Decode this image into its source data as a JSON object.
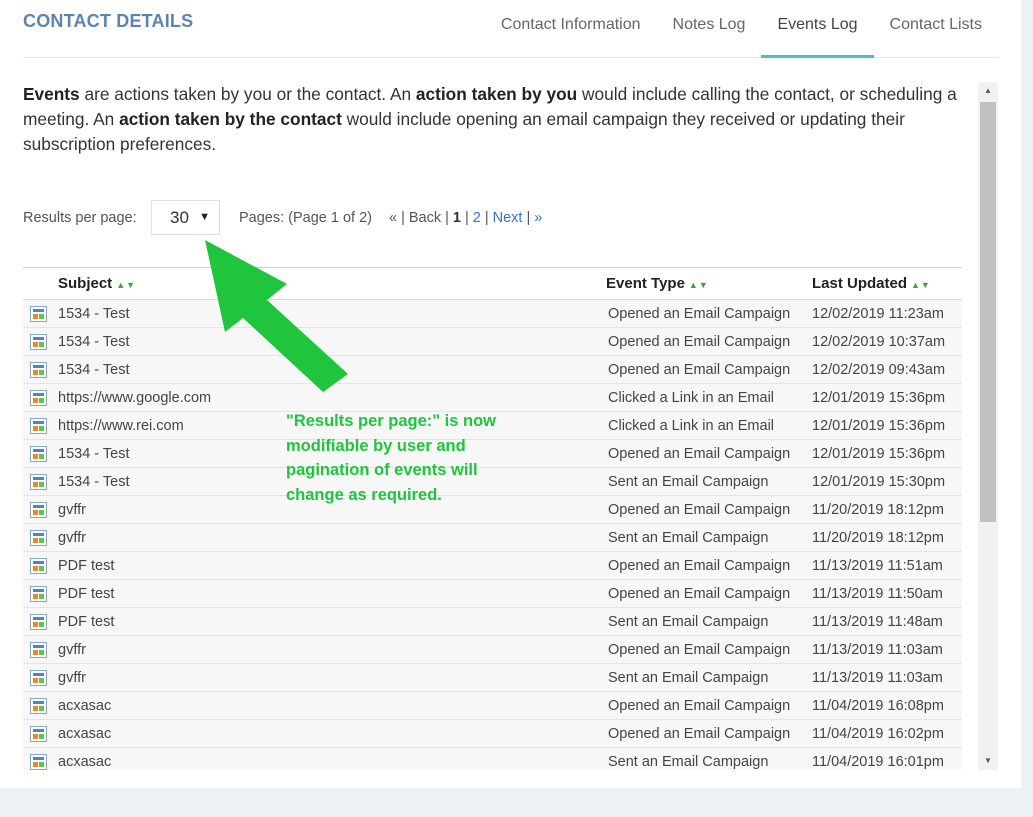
{
  "header": {
    "title": "CONTACT DETAILS",
    "tabs": [
      {
        "label": "Contact Information",
        "active": false
      },
      {
        "label": "Notes Log",
        "active": false
      },
      {
        "label": "Events Log",
        "active": true
      },
      {
        "label": "Contact Lists",
        "active": false
      }
    ]
  },
  "intro": {
    "p1": "Events",
    "p2": " are actions taken by you or the contact. An ",
    "p3": "action taken by you",
    "p4": " would include calling the contact, or scheduling a meeting. An ",
    "p5": "action taken by the contact",
    "p6": " would include opening an email campaign they received or updating their subscription preferences."
  },
  "pager": {
    "results_label": "Results per page:",
    "results_value": "30",
    "pages_info": "Pages: (Page 1 of 2)",
    "first": "«",
    "back": "Back",
    "page1": "1",
    "page2": "2",
    "next": "Next",
    "last": "»",
    "separator": "|"
  },
  "table": {
    "headers": {
      "subject": "Subject",
      "type": "Event Type",
      "updated": "Last Updated"
    },
    "sort_arrows": "▲▼",
    "rows": [
      {
        "subject": "1534 - Test",
        "type": "Opened an Email Campaign",
        "updated": "12/02/2019 11:23am"
      },
      {
        "subject": "1534 - Test",
        "type": "Opened an Email Campaign",
        "updated": "12/02/2019 10:37am"
      },
      {
        "subject": "1534 - Test",
        "type": "Opened an Email Campaign",
        "updated": "12/02/2019 09:43am"
      },
      {
        "subject": "https://www.google.com",
        "type": "Clicked a Link in an Email",
        "updated": "12/01/2019 15:36pm"
      },
      {
        "subject": "https://www.rei.com",
        "type": "Clicked a Link in an Email",
        "updated": "12/01/2019 15:36pm"
      },
      {
        "subject": "1534 - Test",
        "type": "Opened an Email Campaign",
        "updated": "12/01/2019 15:36pm"
      },
      {
        "subject": "1534 - Test",
        "type": "Sent an Email Campaign",
        "updated": "12/01/2019 15:30pm"
      },
      {
        "subject": "gvffr",
        "type": "Opened an Email Campaign",
        "updated": "11/20/2019 18:12pm"
      },
      {
        "subject": "gvffr",
        "type": "Sent an Email Campaign",
        "updated": "11/20/2019 18:12pm"
      },
      {
        "subject": "PDF test",
        "type": "Opened an Email Campaign",
        "updated": "11/13/2019 11:51am"
      },
      {
        "subject": "PDF test",
        "type": "Opened an Email Campaign",
        "updated": "11/13/2019 11:50am"
      },
      {
        "subject": "PDF test",
        "type": "Sent an Email Campaign",
        "updated": "11/13/2019 11:48am"
      },
      {
        "subject": "gvffr",
        "type": "Opened an Email Campaign",
        "updated": "11/13/2019 11:03am"
      },
      {
        "subject": "gvffr",
        "type": "Sent an Email Campaign",
        "updated": "11/13/2019 11:03am"
      },
      {
        "subject": "acxasac",
        "type": "Opened an Email Campaign",
        "updated": "11/04/2019 16:08pm"
      },
      {
        "subject": "acxasac",
        "type": "Opened an Email Campaign",
        "updated": "11/04/2019 16:02pm"
      },
      {
        "subject": "acxasac",
        "type": "Sent an Email Campaign",
        "updated": "11/04/2019 16:01pm"
      }
    ]
  },
  "annotation": {
    "text": "\"Results per page:\" is now modifiable by user and pagination of events will change as required.",
    "color": "#1fc53c"
  },
  "icons": {
    "row": "event-log-icon",
    "select_caret": "caret-down-icon",
    "scroll_up": "scroll-up-icon",
    "scroll_down": "scroll-down-icon"
  },
  "scrollbar": {
    "up": "▲",
    "down": "▼"
  },
  "colors": {
    "title": "#5b84b3",
    "active_tab": "#3ec3cf",
    "link": "#3a73b7",
    "sort": "#3ea23e"
  }
}
